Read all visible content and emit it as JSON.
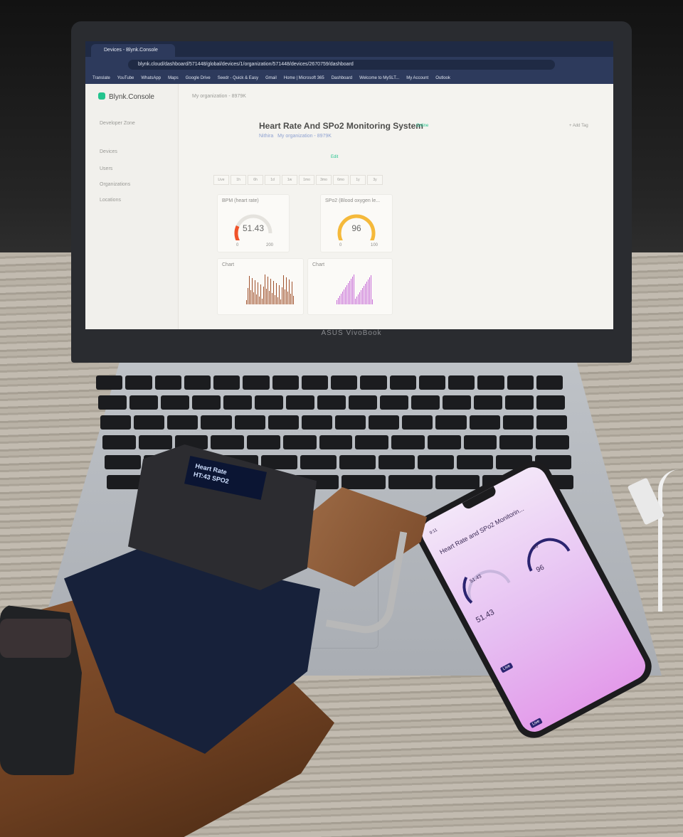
{
  "browser": {
    "tab_title": "Devices - Blynk.Console",
    "url": "blynk.cloud/dashboard/571448/global/devices/1/organization/571448/devices/2670759/dashboard",
    "bookmarks": [
      "Translate",
      "YouTube",
      "WhatsApp",
      "Maps",
      "Google Drive",
      "Seedr - Quick & Easy",
      "Gmail",
      "Home | Microsoft 365",
      "Dashboard",
      "Welcome to MySLT...",
      "My Account",
      "Outlook"
    ],
    "all_bookmarks": "All Bookmarks"
  },
  "app": {
    "logo": "Blynk.Console",
    "workspace": "My organization - 8979K",
    "developer_zone": "Developer Zone",
    "nav": [
      "Devices",
      "Users",
      "Organizations",
      "Locations"
    ],
    "device_title": "Heart Rate And SPo2 Monitoring System",
    "status": "Online",
    "owner": "Nithira",
    "org": "My organization - 8979K",
    "add_tag": "+ Add Tag",
    "edit": "Edit",
    "time_ranges": [
      "Live",
      "1h",
      "6h",
      "1d",
      "1w",
      "1mo",
      "3mo",
      "6mo",
      "1y",
      "3y"
    ],
    "widgets": {
      "bpm": {
        "title": "BPM (heart rate)",
        "value": "51.43",
        "min": "0",
        "max": "200",
        "accent": "#f0532a"
      },
      "spo2": {
        "title": "SPo2 (Blood oxygen le...",
        "value": "96",
        "min": "0",
        "max": "100",
        "accent": "#f5b93a"
      },
      "chart1": {
        "title": "Chart",
        "color": "#a0522d"
      },
      "chart2": {
        "title": "Chart",
        "color": "#c86dd7"
      }
    }
  },
  "laptop": {
    "brand": "ASUS VivoBook"
  },
  "device": {
    "oled_line1": "Heart Rate",
    "oled_line2": "HT:43 SPO2"
  },
  "phone": {
    "time": "9:11",
    "title": "Heart Rate and SPo2 Monitorin...",
    "bpm_value": "51.43",
    "spo2_value": "96",
    "gauge_bpm": "51.43",
    "gauge_spo2": "96",
    "live": "Live"
  }
}
